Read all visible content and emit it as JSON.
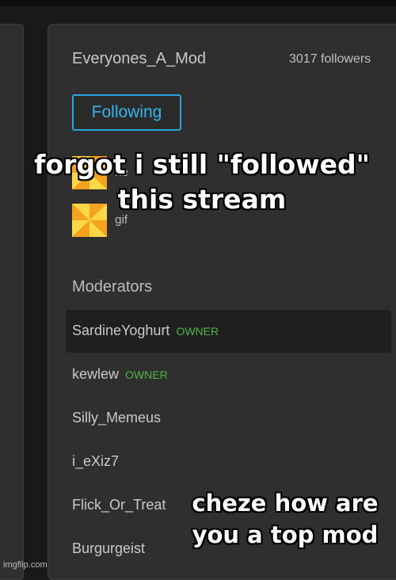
{
  "stream": {
    "name": "Everyones_A_Mod",
    "followers": "3017 followers",
    "follow_button": "Following"
  },
  "badges": [
    {
      "label": "ne",
      "icon": "pinwheel-badge-icon"
    },
    {
      "label": "gif",
      "icon": "pinwheel-badge-icon"
    }
  ],
  "moderators": {
    "title": "Moderators",
    "items": [
      {
        "name": "SardineYoghurt",
        "tag": "OWNER"
      },
      {
        "name": "kewlew",
        "tag": "OWNER"
      },
      {
        "name": "Silly_Memeus",
        "tag": ""
      },
      {
        "name": "i_eXiz7",
        "tag": ""
      },
      {
        "name": "Flick_Or_Treat",
        "tag": ""
      },
      {
        "name": "Burgurgeist",
        "tag": ""
      }
    ]
  },
  "captions": {
    "top": "forgot i still \"followed\" this stream",
    "bottom": "cheze how are you a top mod"
  },
  "watermark": "imgflip.com",
  "colors": {
    "accent": "#35b4ea",
    "owner_tag": "#4eb54a",
    "panel": "#2f2f2f"
  }
}
